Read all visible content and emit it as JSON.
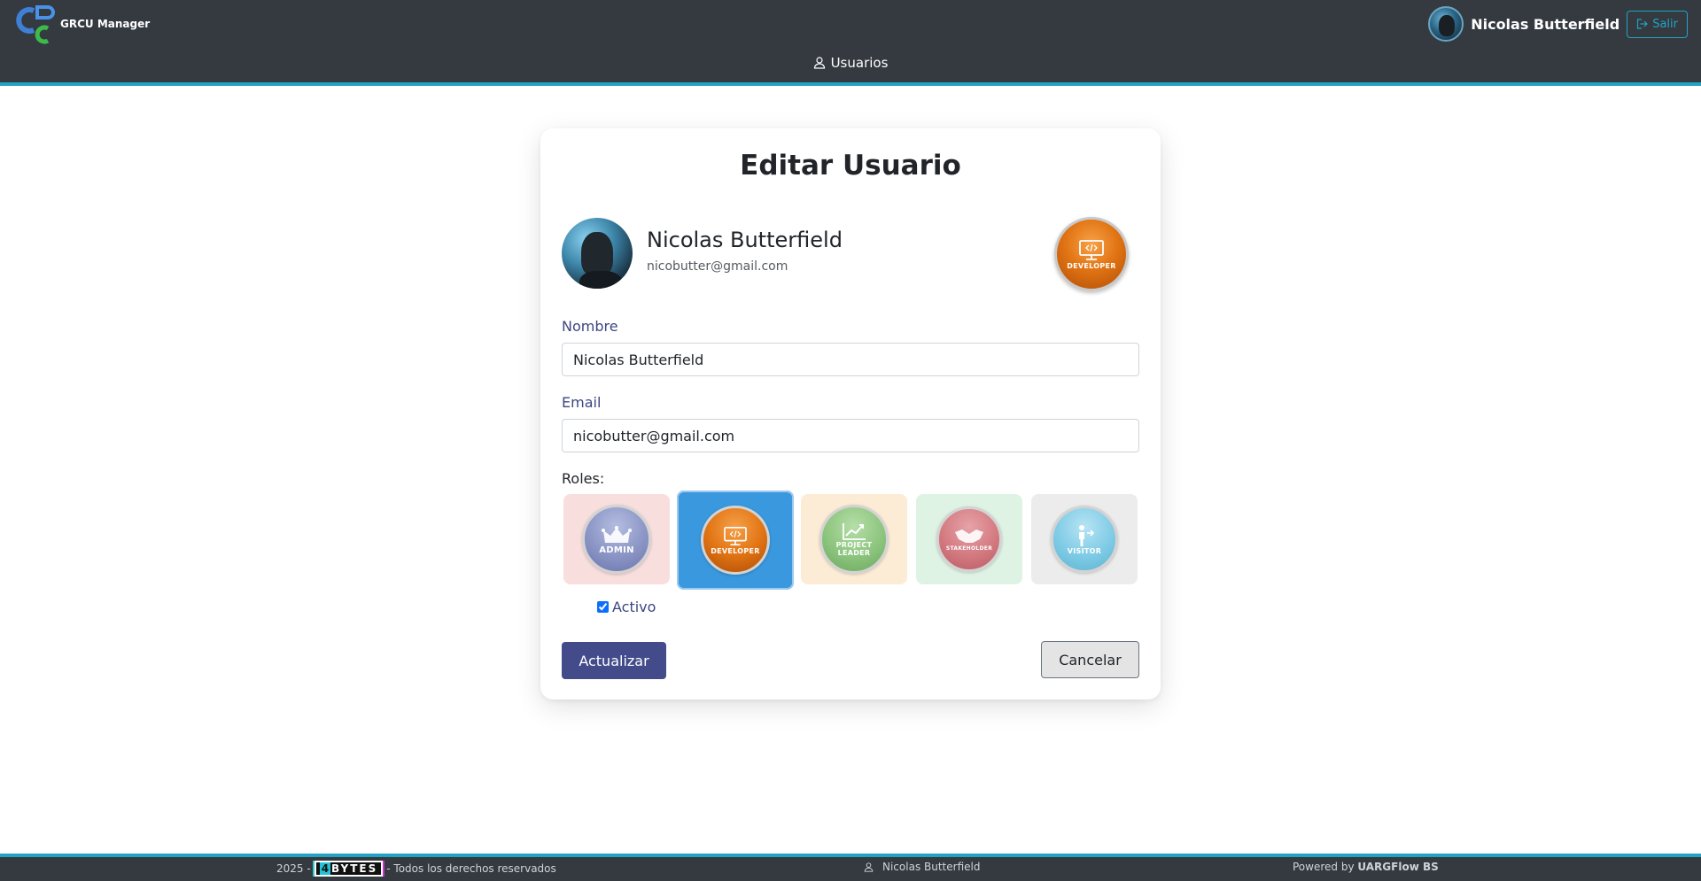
{
  "app": {
    "name": "GRCU Manager"
  },
  "navbar": {
    "user_name": "Nicolas Butterfield",
    "logout_label": "Salir",
    "menu": [
      {
        "label": "Usuarios",
        "icon": "user-icon"
      }
    ]
  },
  "form": {
    "title": "Editar Usuario",
    "profile": {
      "name": "Nicolas Butterfield",
      "email": "nicobutter@gmail.com",
      "badge_label": "DEVELOPER"
    },
    "nombre_label": "Nombre",
    "nombre_value": "Nicolas Butterfield",
    "email_label": "Email",
    "email_value": "nicobutter@gmail.com",
    "roles_label": "Roles:",
    "roles": [
      {
        "label": "ADMIN",
        "icon": "crown-icon",
        "selected": false,
        "card_color": "#f9dede",
        "circle_color": "#8c96c4"
      },
      {
        "label": "DEVELOPER",
        "icon": "monitor-code-icon",
        "selected": true,
        "card_color": "#3a98de",
        "circle_color": "#e07a16"
      },
      {
        "label": "PROJECT LEADER",
        "icon": "chart-icon",
        "selected": false,
        "card_color": "#fcecd6",
        "circle_color": "#8cc47d"
      },
      {
        "label": "STAKEHOLDER",
        "icon": "handshake-icon",
        "selected": false,
        "card_color": "#dff3e5",
        "circle_color": "#d37a80"
      },
      {
        "label": "VISITOR",
        "icon": "person-arrow-icon",
        "selected": false,
        "card_color": "#ececec",
        "circle_color": "#7fcbe6"
      }
    ],
    "activo_label": "Activo",
    "activo_checked": true,
    "update_label": "Actualizar",
    "cancel_label": "Cancelar"
  },
  "footer": {
    "year": "2025 -",
    "brand_four": "4",
    "brand_word": "BYTES",
    "rights": "- Todos los derechos reservados",
    "user_name": "Nicolas Butterfield",
    "powered_prefix": "Powered by",
    "powered_name": "UARGFlow BS"
  },
  "colors": {
    "navbar_bg": "#343a40",
    "accent": "#21a3c4",
    "primary_button": "#434b8a",
    "label_color": "#3c4782"
  }
}
